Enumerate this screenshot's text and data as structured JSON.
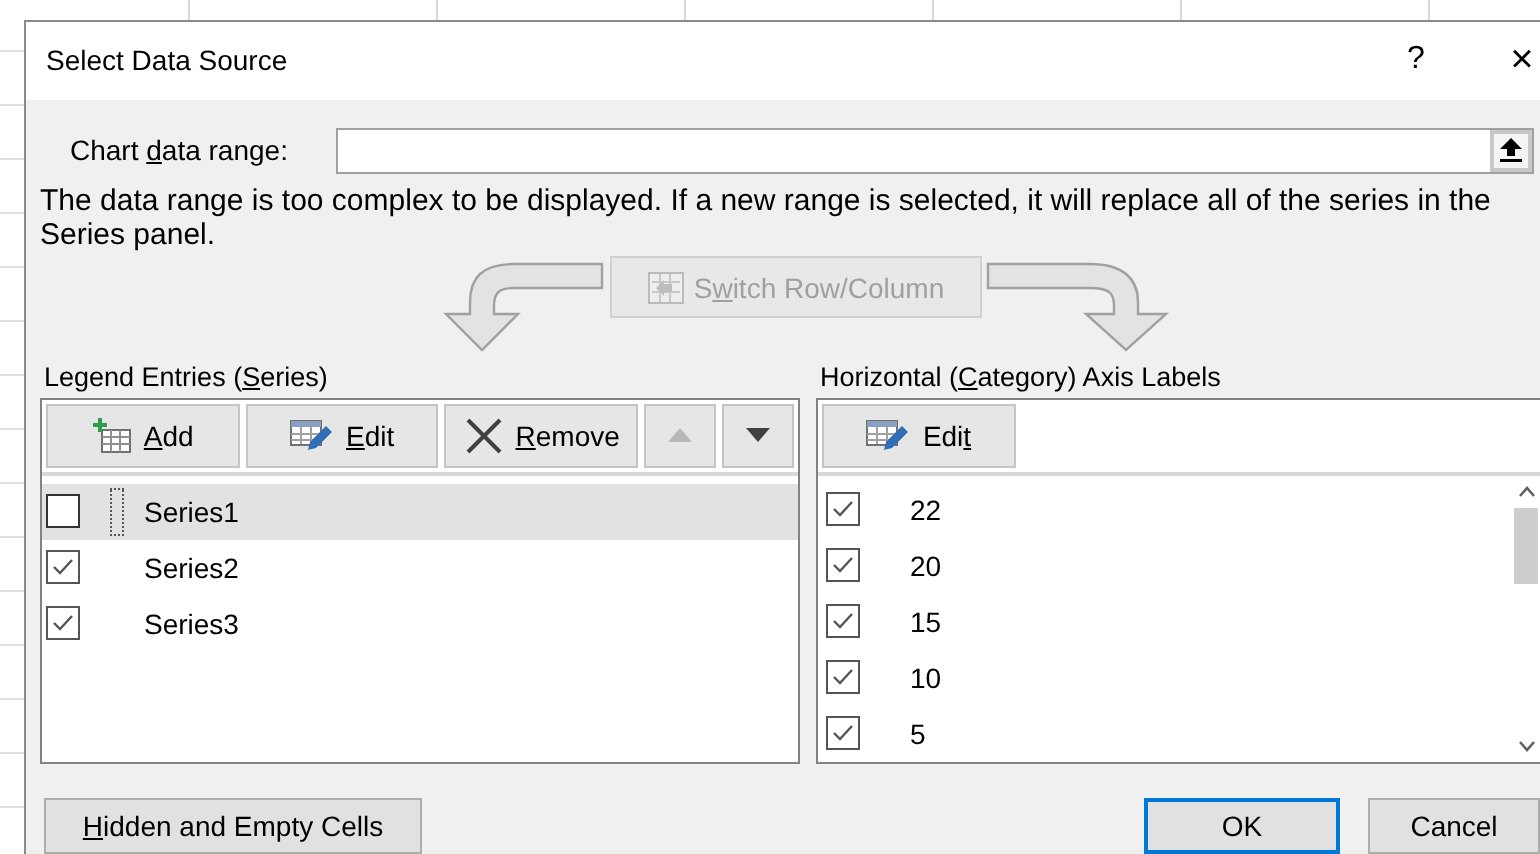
{
  "window": {
    "title": "Select Data Source",
    "help_glyph": "?",
    "close_glyph": "×"
  },
  "chart_data_range": {
    "label_parts": [
      {
        "text": "Chart ",
        "underline": false
      },
      {
        "text": "d",
        "underline": true
      },
      {
        "text": "ata range:",
        "underline": false
      }
    ]
  },
  "message": "The data range is too complex to be displayed. If a new range is selected, it will replace all of the series in the Series panel.",
  "switch_button": {
    "label_parts": [
      {
        "text": "S",
        "underline": false
      },
      {
        "text": "w",
        "underline": true
      },
      {
        "text": "itch Row/Column",
        "underline": false
      }
    ],
    "disabled": true
  },
  "legend_entries": {
    "label_parts": [
      {
        "text": "Legend Entries (",
        "underline": false
      },
      {
        "text": "S",
        "underline": true
      },
      {
        "text": "eries)",
        "underline": false
      }
    ],
    "buttons": [
      {
        "kind": "add",
        "label_parts": [
          {
            "text": "A",
            "underline": true
          },
          {
            "text": "dd",
            "underline": false
          }
        ],
        "disabled": false
      },
      {
        "kind": "edit",
        "label_parts": [
          {
            "text": "E",
            "underline": true
          },
          {
            "text": "dit",
            "underline": false
          }
        ],
        "disabled": false
      },
      {
        "kind": "remove",
        "label_parts": [
          {
            "text": "R",
            "underline": true
          },
          {
            "text": "emove",
            "underline": false
          }
        ],
        "disabled": false
      },
      {
        "kind": "up",
        "disabled": true
      },
      {
        "kind": "down",
        "disabled": false
      }
    ],
    "series": [
      {
        "name": "Series1",
        "checked": false,
        "selected": true
      },
      {
        "name": "Series2",
        "checked": true,
        "selected": false
      },
      {
        "name": "Series3",
        "checked": true,
        "selected": false
      }
    ]
  },
  "axis_labels": {
    "label_parts": [
      {
        "text": "Horizontal (",
        "underline": false
      },
      {
        "text": "C",
        "underline": true
      },
      {
        "text": "ategory) Axis Labels",
        "underline": false
      }
    ],
    "edit_button": {
      "label_parts": [
        {
          "text": "Edi",
          "underline": false
        },
        {
          "text": "t",
          "underline": true
        }
      ]
    },
    "items": [
      {
        "label": "22",
        "checked": true
      },
      {
        "label": "20",
        "checked": true
      },
      {
        "label": "15",
        "checked": true
      },
      {
        "label": "10",
        "checked": true
      },
      {
        "label": "5",
        "checked": true
      }
    ]
  },
  "footer": {
    "hidden_cells_button": {
      "label_parts": [
        {
          "text": "H",
          "underline": true
        },
        {
          "text": "idden and Empty Cells",
          "underline": false
        }
      ]
    },
    "ok_button": {
      "label": "OK",
      "default": true
    },
    "cancel_button": {
      "label": "Cancel"
    }
  }
}
